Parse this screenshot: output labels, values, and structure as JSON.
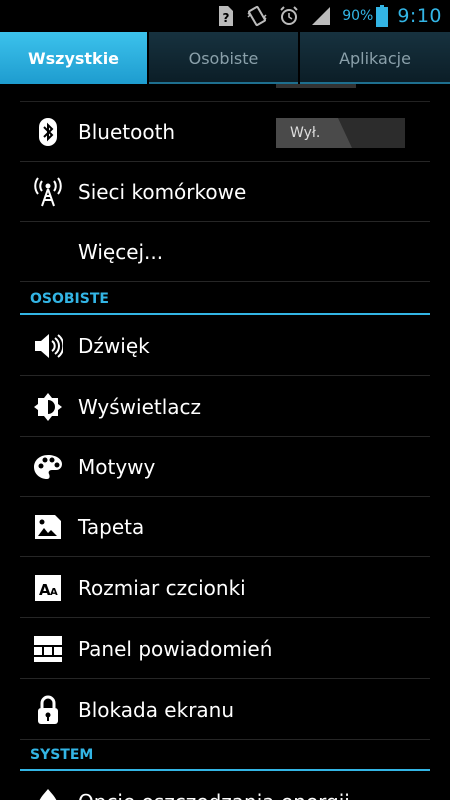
{
  "status_bar": {
    "battery_percent": "90%",
    "time": "9:10",
    "icons": [
      "sim-question-icon",
      "vibrate-icon",
      "alarm-icon",
      "signal-icon",
      "battery-icon"
    ],
    "accent_color": "#33b5e5"
  },
  "tabs": [
    {
      "label": "Wszystkie",
      "active": true
    },
    {
      "label": "Osobiste",
      "active": false
    },
    {
      "label": "Aplikacje",
      "active": false
    }
  ],
  "wireless": {
    "bluetooth": {
      "label": "Bluetooth",
      "toggle_label": "Wył."
    },
    "mobile_networks": {
      "label": "Sieci komórkowe"
    },
    "more": {
      "label": "Więcej..."
    }
  },
  "personal": {
    "header": "OSOBISTE",
    "items": [
      {
        "label": "Dźwięk",
        "icon": "sound-icon"
      },
      {
        "label": "Wyświetlacz",
        "icon": "display-icon"
      },
      {
        "label": "Motywy",
        "icon": "themes-icon"
      },
      {
        "label": "Tapeta",
        "icon": "wallpaper-icon"
      },
      {
        "label": "Rozmiar czcionki",
        "icon": "font-size-icon"
      },
      {
        "label": "Panel powiadomień",
        "icon": "notification-panel-icon"
      },
      {
        "label": "Blokada ekranu",
        "icon": "lock-icon"
      }
    ]
  },
  "system": {
    "header": "SYSTEM",
    "items": [
      {
        "label": "Opcje oszczędzania energii",
        "icon": "power-saving-icon"
      }
    ]
  }
}
